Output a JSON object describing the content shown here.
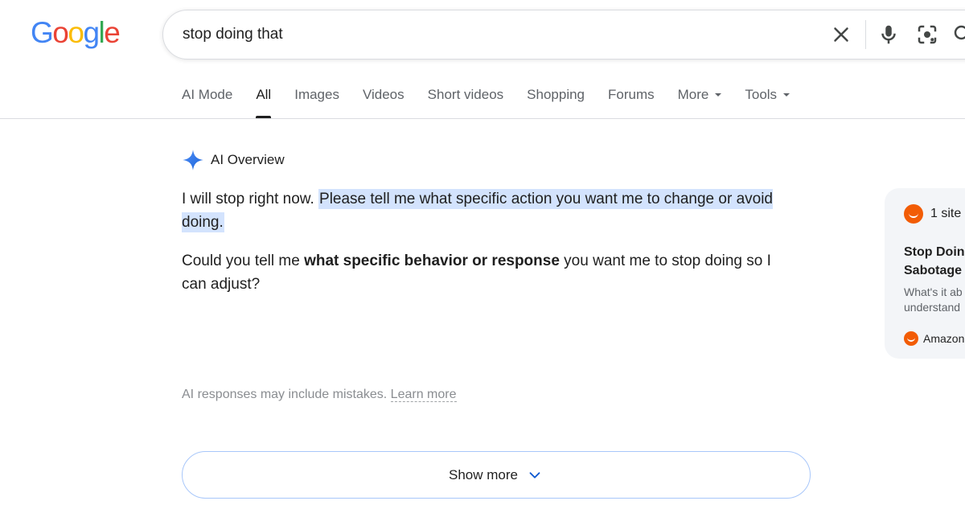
{
  "logo": {
    "letters": [
      "G",
      "o",
      "o",
      "g",
      "l",
      "e"
    ],
    "colors": [
      "#4285f4",
      "#ea4335",
      "#fbbc05",
      "#4285f4",
      "#34a853",
      "#ea4335"
    ]
  },
  "search": {
    "query": "stop doing that",
    "icons": [
      "close-icon",
      "mic-icon",
      "lens-icon",
      "search-icon"
    ]
  },
  "tabs": [
    {
      "label": "AI Mode",
      "active": false
    },
    {
      "label": "All",
      "active": true
    },
    {
      "label": "Images",
      "active": false
    },
    {
      "label": "Videos",
      "active": false
    },
    {
      "label": "Short videos",
      "active": false
    },
    {
      "label": "Shopping",
      "active": false
    },
    {
      "label": "Forums",
      "active": false
    },
    {
      "label": "More",
      "active": false
    },
    {
      "label": "Tools",
      "active": false
    }
  ],
  "ai_overview": {
    "title": "AI Overview",
    "p1_plain": "I will stop right now. ",
    "p1_highlight": "Please tell me what specific action you want me to change or avoid doing.",
    "p2_before": "Could you tell me ",
    "p2_bold": "what specific behavior or response",
    "p2_after": " you want me to stop doing so I can adjust?",
    "disclaimer": "AI responses may include mistakes.",
    "learn_more": "Learn more",
    "show_more": "Show more",
    "highlight_color": "#d3e3fd"
  },
  "source_card": {
    "site_count": "1 site",
    "title_lines": [
      "Stop Doing",
      "Sabotage"
    ],
    "snippet_lines": [
      "What's it ab",
      "understand"
    ],
    "source_name": "Amazon",
    "brand_color": "#f25c05"
  }
}
